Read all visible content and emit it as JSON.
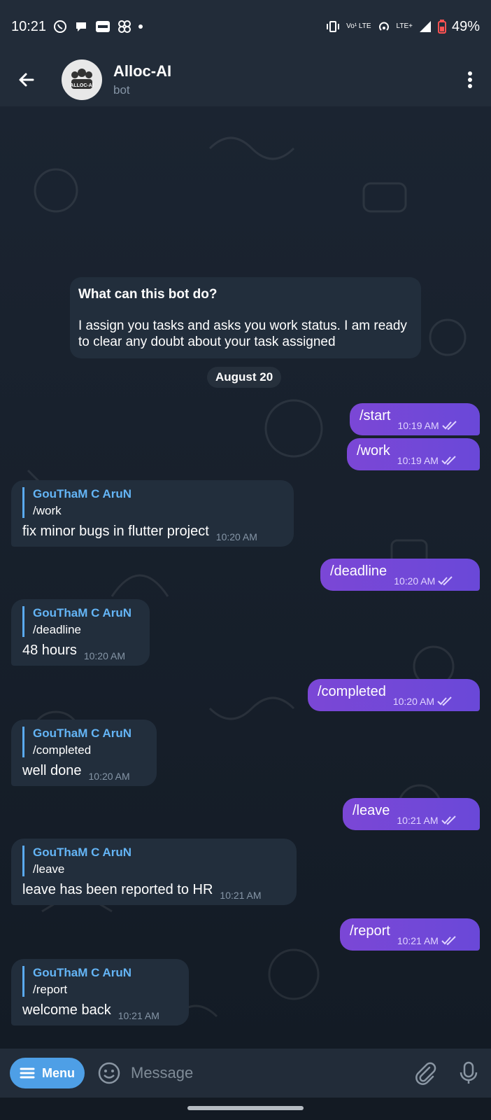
{
  "status_bar": {
    "time": "10:21",
    "battery": "49%",
    "volte_label": "Vo¹ LTE",
    "lte_label": "LTE+",
    "icons": [
      "whatsapp-icon",
      "messages-icon",
      "paytm-icon",
      "pinwheel-icon",
      "dot-icon",
      "vibrate-icon",
      "volte-icon",
      "hotspot-icon",
      "signal-icon",
      "battery-icon"
    ]
  },
  "header": {
    "title": "Alloc-AI",
    "subtitle": "bot",
    "avatar_text": "ALLOC-AI"
  },
  "bot_info": {
    "title": "What can this bot do?",
    "body": "I assign you tasks and asks you work status. I am ready to clear any doubt about your task assigned"
  },
  "date_chip": "August 20",
  "messages_out": [
    {
      "text": "/start",
      "time": "10:19 AM"
    },
    {
      "text": "/work",
      "time": "10:19 AM"
    },
    {
      "text": "/deadline",
      "time": "10:20 AM"
    },
    {
      "text": "/completed",
      "time": "10:20 AM"
    },
    {
      "text": "/leave",
      "time": "10:21 AM"
    },
    {
      "text": "/report",
      "time": "10:21 AM"
    }
  ],
  "messages_in": [
    {
      "reply_name": "GouThaM C AruN",
      "reply_text": "/work",
      "text": "fix minor bugs in flutter project",
      "time": "10:20 AM"
    },
    {
      "reply_name": "GouThaM C AruN",
      "reply_text": "/deadline",
      "text": "48 hours",
      "time": "10:20 AM"
    },
    {
      "reply_name": "GouThaM C AruN",
      "reply_text": "/completed",
      "text": "well done",
      "time": "10:20 AM"
    },
    {
      "reply_name": "GouThaM C AruN",
      "reply_text": "/leave",
      "text": "leave has been reported to HR",
      "time": "10:21 AM"
    },
    {
      "reply_name": "GouThaM C AruN",
      "reply_text": "/report",
      "text": "welcome back",
      "time": "10:21 AM"
    }
  ],
  "input_bar": {
    "menu_label": "Menu",
    "placeholder": "Message"
  },
  "colors": {
    "header_bg": "#222c39",
    "outgoing_bubble": "#7b47d6",
    "incoming_bubble": "#222e3c",
    "reply_name": "#64b5f6",
    "menu_button": "#4e9fe6"
  }
}
